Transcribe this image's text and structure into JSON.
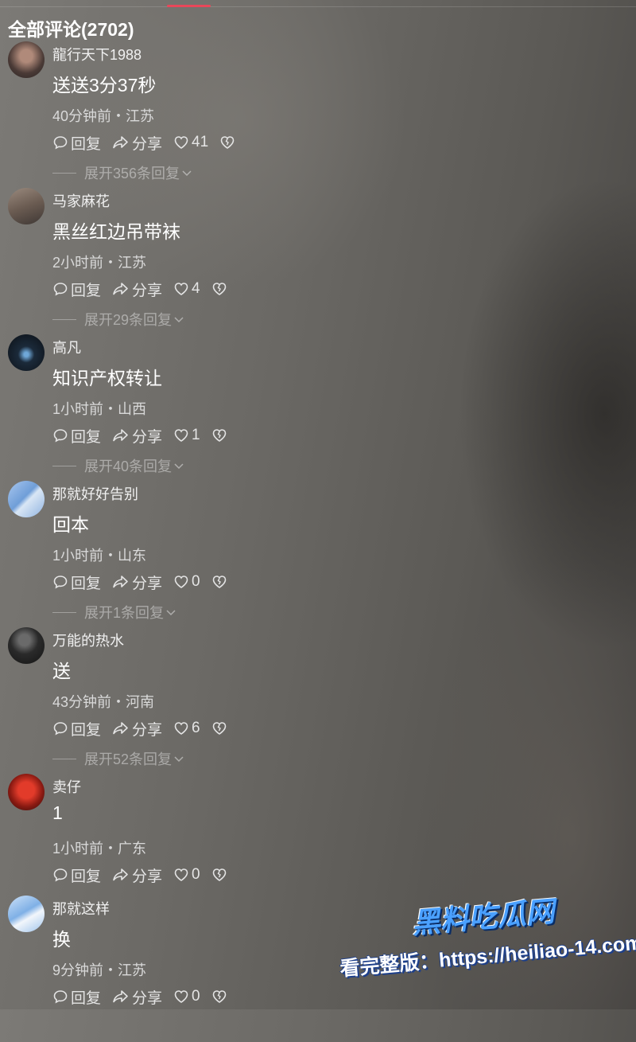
{
  "header": {
    "title": "全部评论(2702)"
  },
  "labels": {
    "reply": "回复",
    "share": "分享"
  },
  "comments": [
    {
      "username": "龍行天下1988",
      "content": "送送3分37秒",
      "meta": "40分钟前・江苏",
      "likes": "41",
      "expand": "展开356条回复"
    },
    {
      "username": "马家麻花",
      "content": "黑丝红边吊带袜",
      "meta": "2小时前・江苏",
      "likes": "4",
      "expand": "展开29条回复"
    },
    {
      "username": "高凡",
      "content": "知识产权转让",
      "meta": "1小时前・山西",
      "likes": "1",
      "expand": "展开40条回复"
    },
    {
      "username": "那就好好告别",
      "content": "回本",
      "meta": "1小时前・山东",
      "likes": "0",
      "expand": "展开1条回复"
    },
    {
      "username": "万能的热水",
      "content": "送",
      "meta": "43分钟前・河南",
      "likes": "6",
      "expand": "展开52条回复"
    },
    {
      "username": "卖仔",
      "content": "1",
      "meta": "1小时前・广东",
      "likes": "0",
      "expand": ""
    },
    {
      "username": "那就这样",
      "content": "换",
      "meta": "9分钟前・江苏",
      "likes": "0",
      "expand": ""
    }
  ],
  "watermark": {
    "title": "黑料吃瓜网",
    "url": "看完整版：https://heiliao-14.com"
  },
  "colors": {
    "accent": "#e8475a",
    "watermark_blue": "#4aa0ff"
  }
}
